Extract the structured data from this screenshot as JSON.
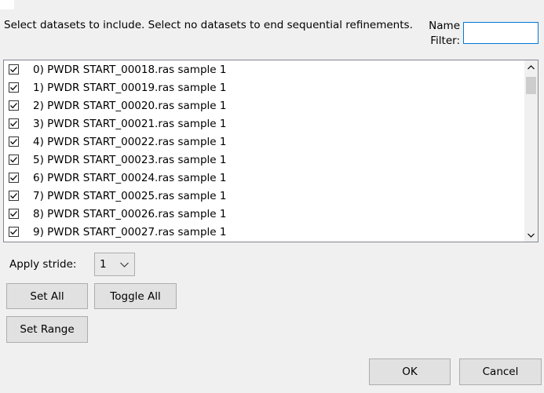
{
  "dialog": {
    "prompt": "Select datasets to include. Select no datasets to end sequential refinements.",
    "filter_label_line1": "Name",
    "filter_label_line2": "Filter:",
    "filter_value": ""
  },
  "datasets": [
    {
      "label": "0) PWDR START_00018.ras sample 1",
      "checked": true
    },
    {
      "label": "1) PWDR START_00019.ras sample 1",
      "checked": true
    },
    {
      "label": "2) PWDR START_00020.ras sample 1",
      "checked": true
    },
    {
      "label": "3) PWDR START_00021.ras sample 1",
      "checked": true
    },
    {
      "label": "4) PWDR START_00022.ras sample 1",
      "checked": true
    },
    {
      "label": "5) PWDR START_00023.ras sample 1",
      "checked": true
    },
    {
      "label": "6) PWDR START_00024.ras sample 1",
      "checked": true
    },
    {
      "label": "7) PWDR START_00025.ras sample 1",
      "checked": true
    },
    {
      "label": "8) PWDR START_00026.ras sample 1",
      "checked": true
    },
    {
      "label": "9) PWDR START_00027.ras sample 1",
      "checked": true
    }
  ],
  "stride": {
    "label": "Apply stride:",
    "value": "1"
  },
  "buttons": {
    "set_all": "Set All",
    "toggle_all": "Toggle All",
    "set_range": "Set Range",
    "ok": "OK",
    "cancel": "Cancel"
  },
  "icons": {
    "checkbox_check": "check-icon",
    "scroll_up": "chevron-up-icon",
    "scroll_down": "chevron-down-icon",
    "dropdown": "chevron-down-icon"
  },
  "colors": {
    "focus_border": "#0078d7",
    "button_face": "#e1e1e1",
    "dialog_bg": "#f0f0f0"
  }
}
